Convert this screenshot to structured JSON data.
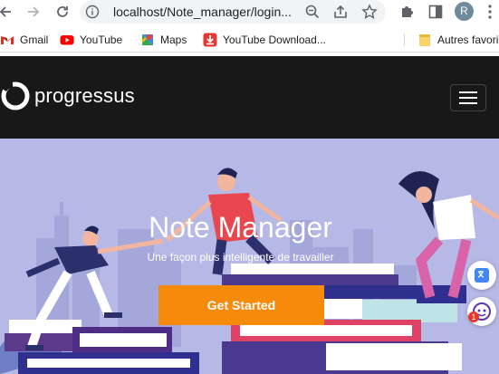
{
  "browser": {
    "url": "localhost/Note_manager/login...",
    "profile_initial": "R"
  },
  "bookmarks": [
    {
      "label": "Gmail",
      "icon": "gmail-icon"
    },
    {
      "label": "YouTube",
      "icon": "youtube-icon"
    },
    {
      "label": "Maps",
      "icon": "maps-icon"
    },
    {
      "label": "YouTube Download...",
      "icon": "download-icon"
    },
    {
      "label": "Autres favoris",
      "icon": "folder-icon"
    }
  ],
  "site": {
    "brand": "progressus"
  },
  "hero": {
    "title": "Note Manager",
    "subtitle": "Une façon plus intelligente de travailler",
    "cta_label": "Get Started",
    "notification_count": "1"
  },
  "colors": {
    "hero_bg": "#b6b9e6",
    "navbar_bg": "#181818",
    "cta": "#f68a0a"
  }
}
